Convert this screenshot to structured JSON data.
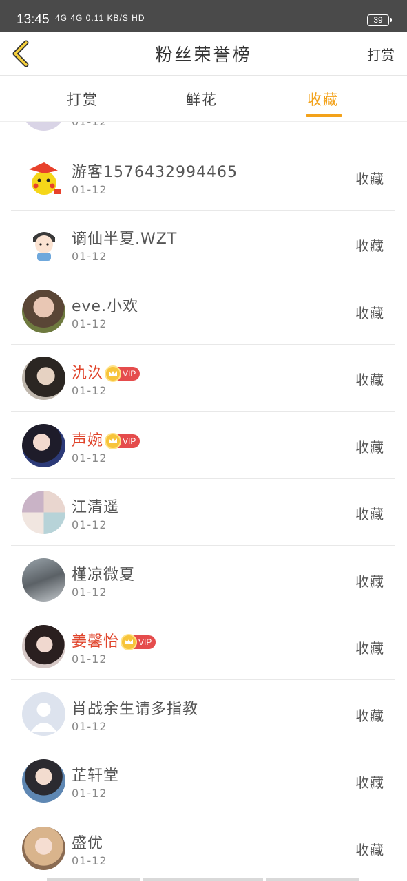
{
  "status_bar": {
    "time": "13:45",
    "network": "4G 4G 0.11 KB/S HD",
    "battery": "39"
  },
  "nav": {
    "title": "粉丝荣誉榜",
    "action": "打赏",
    "back_icon": "chevron-left-icon",
    "accent": "#f3a21a"
  },
  "tabs": [
    {
      "label": "打赏",
      "active": false
    },
    {
      "label": "鲜花",
      "active": false
    },
    {
      "label": "收藏",
      "active": true
    }
  ],
  "partial_row": {
    "date": "01-12"
  },
  "rows": [
    {
      "name": "游客1576432994465",
      "date": "01-12",
      "action": "收藏",
      "vip": false,
      "avatar": "pikachu-avatar"
    },
    {
      "name": "谪仙半夏.WZT",
      "date": "01-12",
      "action": "收藏",
      "vip": false,
      "avatar": "cartoon-boy-avatar"
    },
    {
      "name": "eve.小欢",
      "date": "01-12",
      "action": "收藏",
      "vip": false,
      "avatar": "photo-avatar"
    },
    {
      "name": "氿汣",
      "date": "01-12",
      "action": "收藏",
      "vip": true,
      "vip_label": "VIP",
      "avatar": "photo-avatar"
    },
    {
      "name": "声婉",
      "date": "01-12",
      "action": "收藏",
      "vip": true,
      "vip_label": "VIP",
      "avatar": "photo-avatar"
    },
    {
      "name": "江清遥",
      "date": "01-12",
      "action": "收藏",
      "vip": false,
      "avatar": "collage-avatar"
    },
    {
      "name": "槿凉微夏",
      "date": "01-12",
      "action": "收藏",
      "vip": false,
      "avatar": "photo-avatar"
    },
    {
      "name": "姜馨怡",
      "date": "01-12",
      "action": "收藏",
      "vip": true,
      "vip_label": "VIP",
      "avatar": "photo-avatar"
    },
    {
      "name": "肖战余生请多指教",
      "date": "01-12",
      "action": "收藏",
      "vip": false,
      "avatar": "default-user-avatar"
    },
    {
      "name": "芷轩堂",
      "date": "01-12",
      "action": "收藏",
      "vip": false,
      "avatar": "photo-avatar"
    },
    {
      "name": "盛优",
      "date": "01-12",
      "action": "收藏",
      "vip": false,
      "avatar": "photo-avatar"
    }
  ]
}
